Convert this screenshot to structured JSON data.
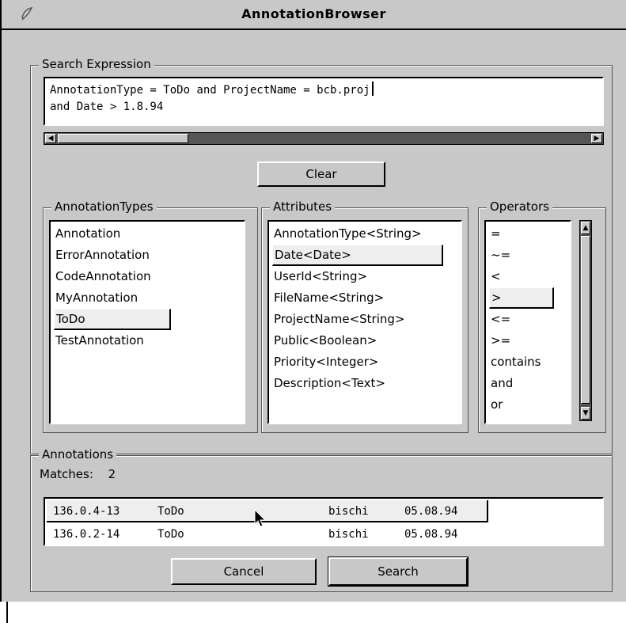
{
  "window": {
    "title": "AnnotationBrowser",
    "menu_icon": "window-menu-icon"
  },
  "search": {
    "label": "Search Expression",
    "line1": "AnnotationType = ToDo and ProjectName = bcb.proj",
    "line2": "and Date > 1.8.94",
    "clear_label": "Clear"
  },
  "annotation_types": {
    "label": "AnnotationTypes",
    "items": [
      "Annotation",
      "ErrorAnnotation",
      "CodeAnnotation",
      "MyAnnotation",
      "ToDo",
      "TestAnnotation"
    ],
    "selected": "ToDo"
  },
  "attributes": {
    "label": "Attributes",
    "items": [
      "AnnotationType<String>",
      "Date<Date>",
      "UserId<String>",
      "FileName<String>",
      "ProjectName<String>",
      "Public<Boolean>",
      "Priority<Integer>",
      "Description<Text>"
    ],
    "selected": "Date<Date>"
  },
  "operators": {
    "label": "Operators",
    "items": [
      "=",
      "~=",
      "<",
      ">",
      "<=",
      ">=",
      "contains",
      "and",
      "or"
    ],
    "selected": ">"
  },
  "annotations": {
    "label": "Annotations",
    "matches_label": "Matches:",
    "matches_count": "2",
    "rows": [
      {
        "id": "136.0.4-13",
        "type": "ToDo",
        "user": "bischi",
        "date": "05.08.94"
      },
      {
        "id": "136.0.2-14",
        "type": "ToDo",
        "user": "bischi",
        "date": "05.08.94"
      }
    ],
    "selected_row": 0
  },
  "buttons": {
    "cancel_label": "Cancel",
    "search_label": "Search"
  },
  "colors": {
    "background": "#c8c8c8",
    "field": "#ffffff",
    "scroll_trough": "#555555",
    "selection": "#eeeeee"
  }
}
